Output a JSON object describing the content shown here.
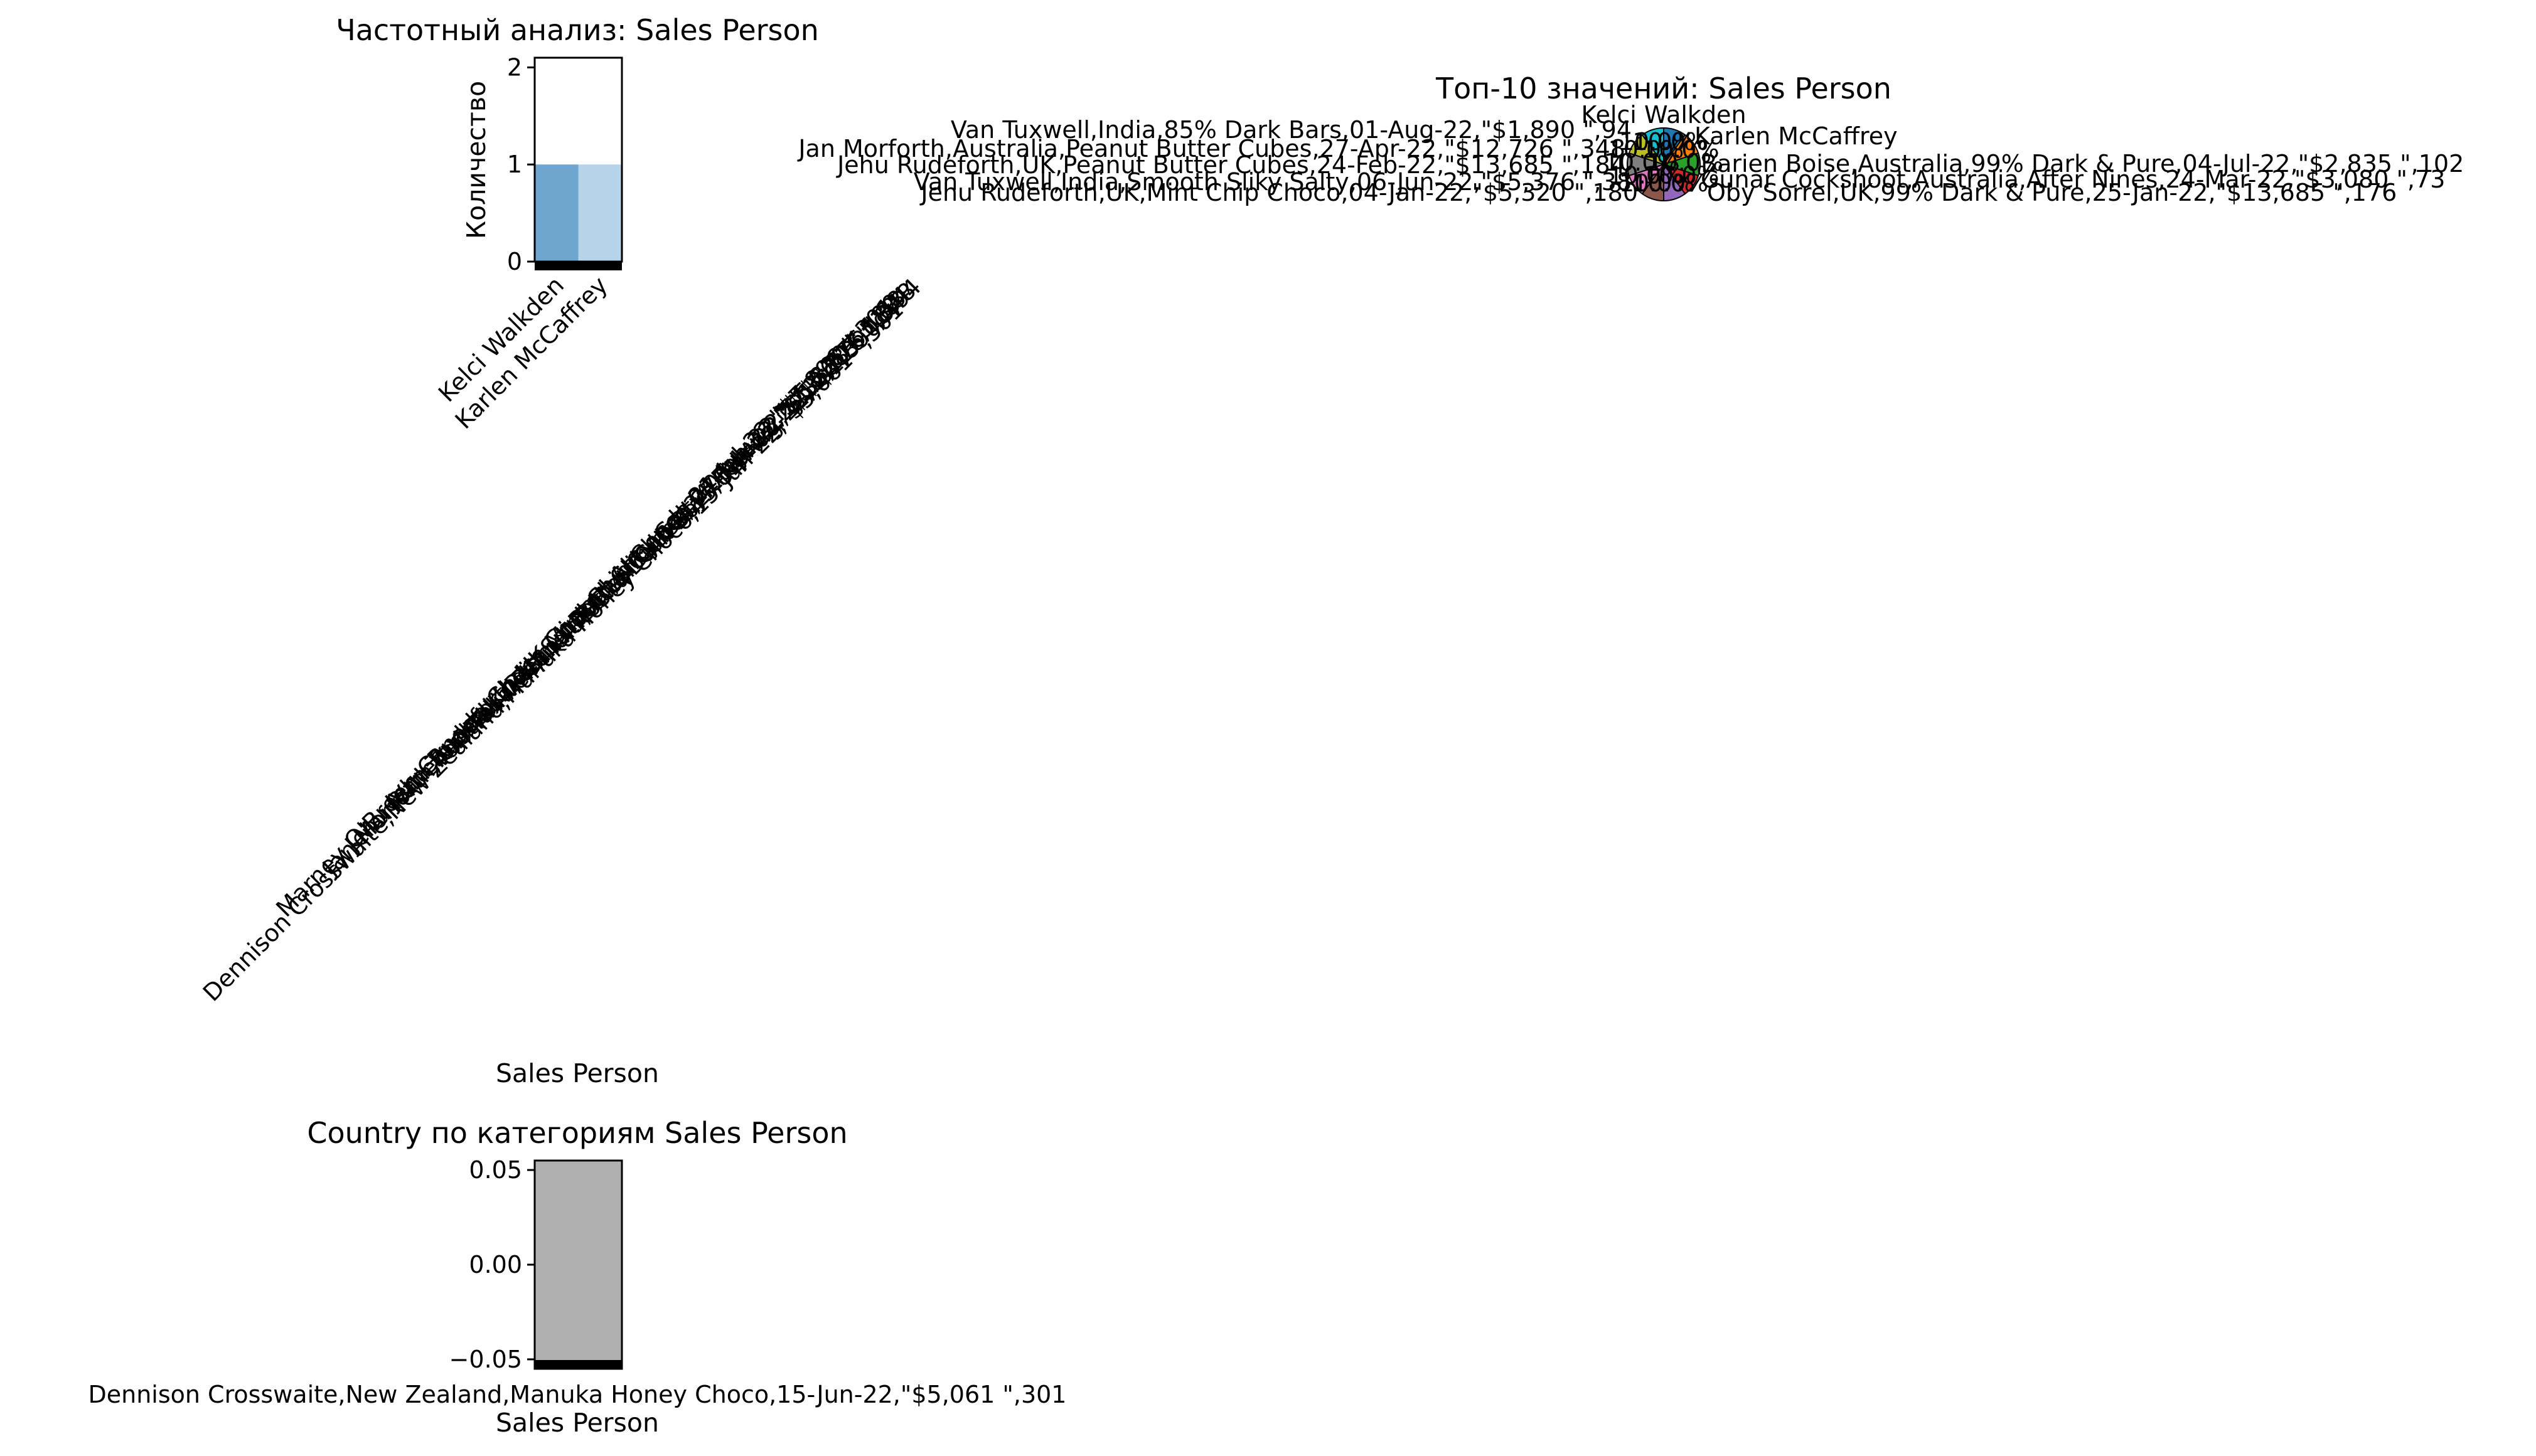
{
  "chart_data": [
    {
      "type": "bar",
      "title": "Частотный анализ: Sales Person",
      "xlabel": "Sales Person",
      "ylabel": "Количество",
      "ylim": [
        0,
        2.1
      ],
      "yticks": [
        "0",
        "1",
        "2"
      ],
      "categories": [
        "Kelci Walkden",
        "Karlen McCaffrey"
      ],
      "values": [
        1,
        1
      ],
      "colors": [
        "#6ea6d0",
        "#b5d4e9"
      ],
      "overflow_labels": [
        "Van Tuxwell,India,85% Dark Bars,01-Aug-22,\"$1,890 \",94",
        "Jan Morforth,Australia,Peanut Butter Cubes,27-Apr-22,\"$12,726 \",348",
        "Jehu Rudeforth,UK,Peanut Butter Cubes,24-Feb-22,\"$13,685 \",184",
        "Van Tuxwell,India,Smooth Sliky Salty,06-Jun-22,\"$5,376 \",38",
        "Jehu Rudeforth,UK,Mint Chip Choco,04-Jan-22,\"$5,320 \",180",
        "Marney O'Breen,Canada,Choco Coated Almonds,21-Jul-22,\"$7,896 \",301",
        "Dennison Crosswaite,New Zealand,Manuka Honey Choco,15-Jun-22,\"$5,061 \",301"
      ]
    },
    {
      "type": "pie",
      "title": "Топ-10 значений: Sales Person",
      "slices": [
        {
          "label": "Kelci Walkden",
          "value": 10,
          "pct": "10.0%",
          "color": "#1f77b4"
        },
        {
          "label": "Karlen McCaffrey",
          "value": 10,
          "pct": "10.0%",
          "color": "#ff7f0e"
        },
        {
          "label": "Barien Boise,Australia,99% Dark & Pure,04-Jul-22,\"$2,835 \",102",
          "value": 10,
          "pct": "10.0%",
          "color": "#2ca02c"
        },
        {
          "label": "Gunar Cockshoot,Australia,After Nines,24-Mar-22,\"$3,080 \",73",
          "value": 10,
          "pct": "10.0%",
          "color": "#d62728"
        },
        {
          "label": "Oby Sorrel,UK,99% Dark & Pure,25-Jan-22,\"$13,685 \",176",
          "value": 10,
          "pct": "10.0%",
          "color": "#9467bd"
        },
        {
          "label": "Jehu Rudeforth,UK,Mint Chip Choco,04-Jan-22,\"$5,320 \",180",
          "value": 10,
          "pct": "10.0%",
          "color": "#8c564b"
        },
        {
          "label": "Van Tuxwell,India,Smooth Sliky Salty,06-Jun-22,\"$5,376 \",38",
          "value": 10,
          "pct": "10.0%",
          "color": "#e377c2"
        },
        {
          "label": "Jehu Rudeforth,UK,Peanut Butter Cubes,24-Feb-22,\"$13,685 \",184",
          "value": 10,
          "pct": "10.0%",
          "color": "#7f7f7f"
        },
        {
          "label": "Jan Morforth,Australia,Peanut Butter Cubes,27-Apr-22,\"$12,726 \",348",
          "value": 10,
          "pct": "10.0%",
          "color": "#bcbd22"
        },
        {
          "label": "Van Tuxwell,India,85% Dark Bars,01-Aug-22,\"$1,890 \",94",
          "value": 10,
          "pct": "10.0%",
          "color": "#17becf"
        }
      ]
    },
    {
      "type": "bar",
      "title": "Country по категориям Sales Person",
      "xlabel": "Sales Person",
      "ylabel": "",
      "ylim": [
        -0.055,
        0.055
      ],
      "yticks": [
        "0.05",
        "0.00",
        "−0.05"
      ],
      "categories": [
        "Dennison Crosswaite,New Zealand,Manuka Honey Choco,15-Jun-22,\"$5,061 \",301"
      ],
      "values": [
        0
      ],
      "colors": [
        "#b0b0b0"
      ]
    }
  ]
}
